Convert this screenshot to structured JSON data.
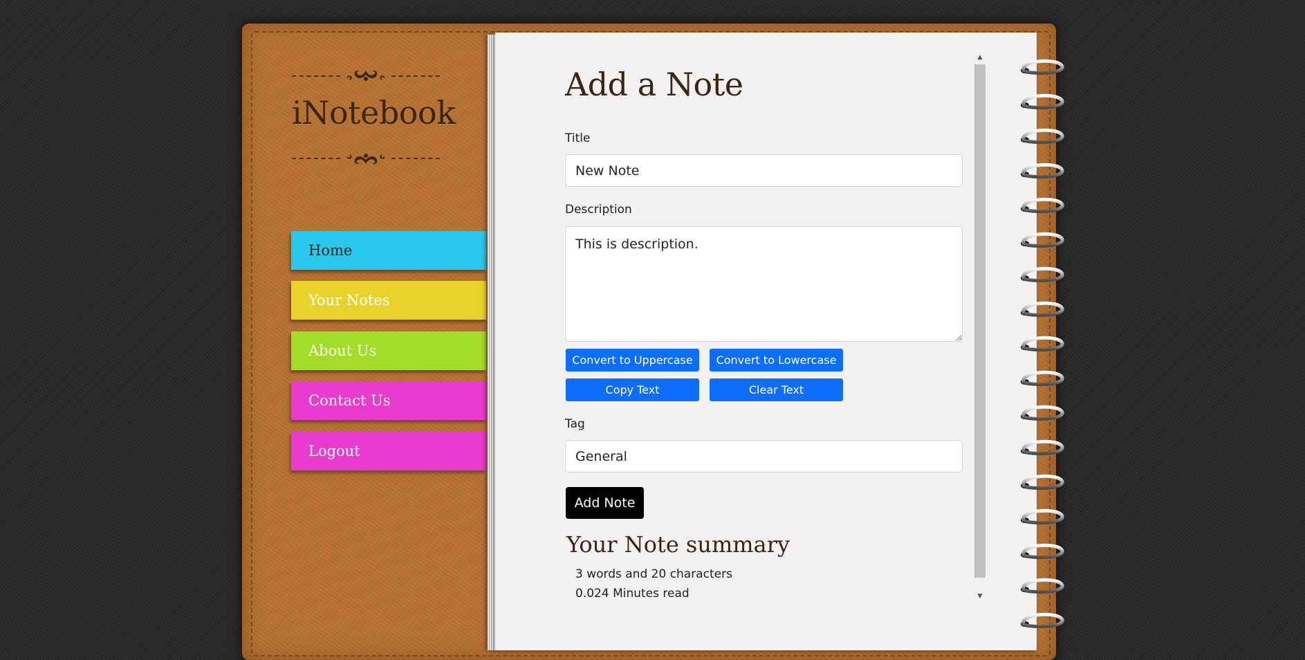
{
  "brand": {
    "name": "iNotebook"
  },
  "nav": {
    "items": [
      {
        "label": "Home",
        "color": "#29c7ea"
      },
      {
        "label": "Your Notes",
        "color": "#e9d32b"
      },
      {
        "label": "About Us",
        "color": "#a2db2a"
      },
      {
        "label": "Contact Us",
        "color": "#e93bcd"
      },
      {
        "label": "Logout",
        "color": "#e93bcd"
      }
    ]
  },
  "form": {
    "heading": "Add a Note",
    "title_label": "Title",
    "title_value": "New Note",
    "description_label": "Description",
    "description_value": "This is description.",
    "tag_label": "Tag",
    "tag_value": "General",
    "submit_label": "Add Note"
  },
  "text_tools": {
    "uppercase_label": "Convert to Uppercase",
    "lowercase_label": "Convert to Lowercase",
    "copy_label": "Copy Text",
    "clear_label": "Clear Text"
  },
  "summary": {
    "heading": "Your Note summary",
    "word_count_text": "3 words and 20 characters",
    "read_time_text": "0.024 Minutes read"
  },
  "colors": {
    "cover": "#b87333",
    "page": "#f3f1f1",
    "button_primary": "#0d6efd",
    "button_dark": "#000000",
    "heading_text": "#3b2410"
  }
}
